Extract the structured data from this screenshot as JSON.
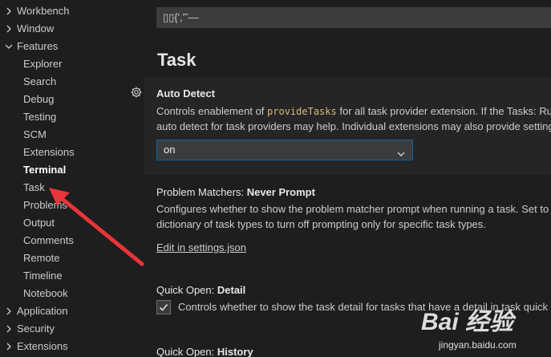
{
  "sidebar": {
    "items": [
      {
        "label": "Workbench",
        "expandable": true,
        "expanded": false
      },
      {
        "label": "Window",
        "expandable": true,
        "expanded": false
      },
      {
        "label": "Features",
        "expandable": true,
        "expanded": true
      },
      {
        "label": "Explorer"
      },
      {
        "label": "Search"
      },
      {
        "label": "Debug"
      },
      {
        "label": "Testing"
      },
      {
        "label": "SCM"
      },
      {
        "label": "Extensions"
      },
      {
        "label": "Terminal",
        "active": true
      },
      {
        "label": "Task"
      },
      {
        "label": "Problems"
      },
      {
        "label": "Output"
      },
      {
        "label": "Comments"
      },
      {
        "label": "Remote"
      },
      {
        "label": "Timeline"
      },
      {
        "label": "Notebook"
      },
      {
        "label": "Application",
        "expandable": true,
        "expanded": false
      },
      {
        "label": "Security",
        "expandable": true,
        "expanded": false
      },
      {
        "label": "Extensions",
        "expandable": true,
        "expanded": false
      }
    ]
  },
  "main": {
    "top_input_value": "▯▯{','˜—",
    "section_title": "Task",
    "auto_detect": {
      "title": "Auto Detect",
      "desc_line1_pre": "Controls enablement of ",
      "desc_line1_code": "provideTasks",
      "desc_line1_post": " for all task provider extension. If the Tasks: Ru",
      "desc_line2": "auto detect for task providers may help. Individual extensions may also provide setting",
      "select_value": "on"
    },
    "problem_matchers": {
      "category": "Problem Matchers: ",
      "name": "Never Prompt",
      "desc_line1": "Configures whether to show the problem matcher prompt when running a task. Set to",
      "desc_line2": "dictionary of task types to turn off prompting only for specific task types.",
      "link": "Edit in settings.json"
    },
    "quick_open_detail": {
      "category": "Quick Open: ",
      "name": "Detail",
      "desc": "Controls whether to show the task detail for tasks that have a detail in task quick p"
    },
    "quick_open_history": {
      "category": "Quick Open: ",
      "name": "History"
    }
  },
  "watermark": {
    "main": "Bai 经验",
    "sub": "jingyan.baidu.com"
  },
  "colors": {
    "background": "#1e1e1e",
    "focused_setting": "#252526",
    "input_bg": "#3c3c3c",
    "focus_border": "#0e639c",
    "arrow": "#e8343a"
  }
}
